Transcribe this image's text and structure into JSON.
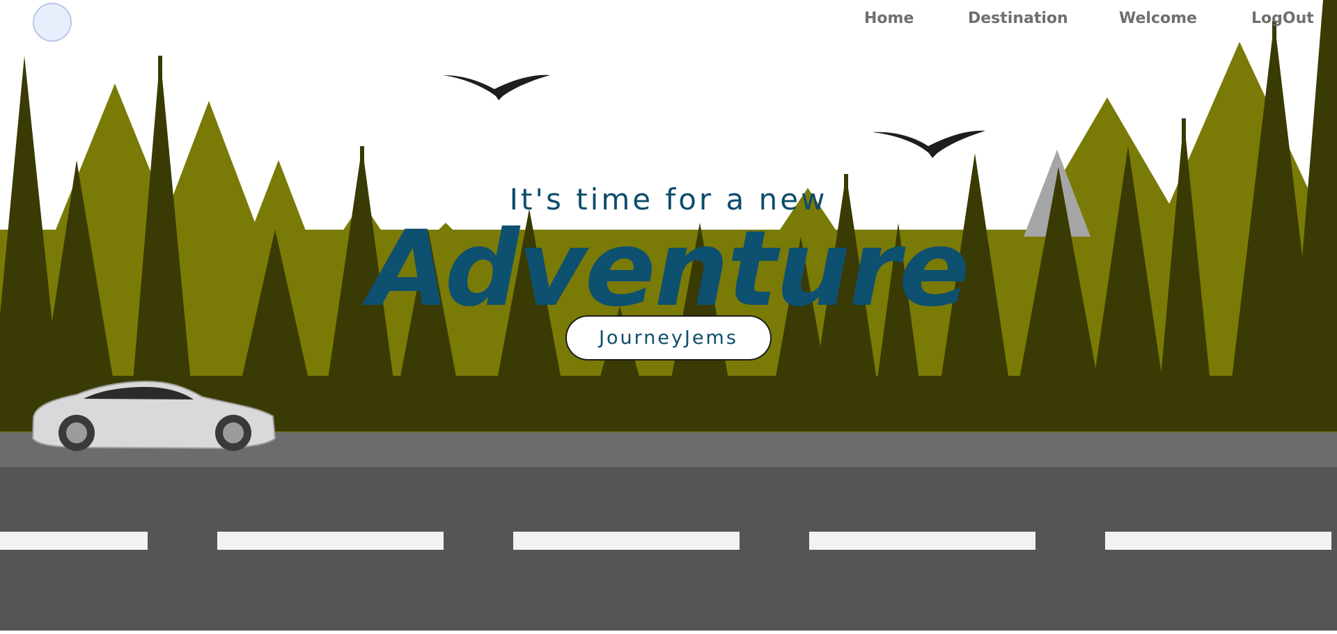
{
  "nav": {
    "logo_name": "journeyjems-logo",
    "links": [
      "Home",
      "Destination",
      "Welcome",
      "LogOut"
    ]
  },
  "hero": {
    "subtitle": "It's time for a new",
    "headline": "Adventure",
    "cta_label": "JourneyJems"
  },
  "colors": {
    "forest_light": "#7a7a07",
    "forest_dark": "#3a3a04",
    "road_top": "#6c6c6c",
    "road": "#555555",
    "lane": "#f2f2f2",
    "text_primary": "#0d4c6b",
    "nav_text": "#6f6f6f"
  },
  "icons": [
    "bird-icon",
    "car-icon",
    "pine-tree-icon"
  ]
}
